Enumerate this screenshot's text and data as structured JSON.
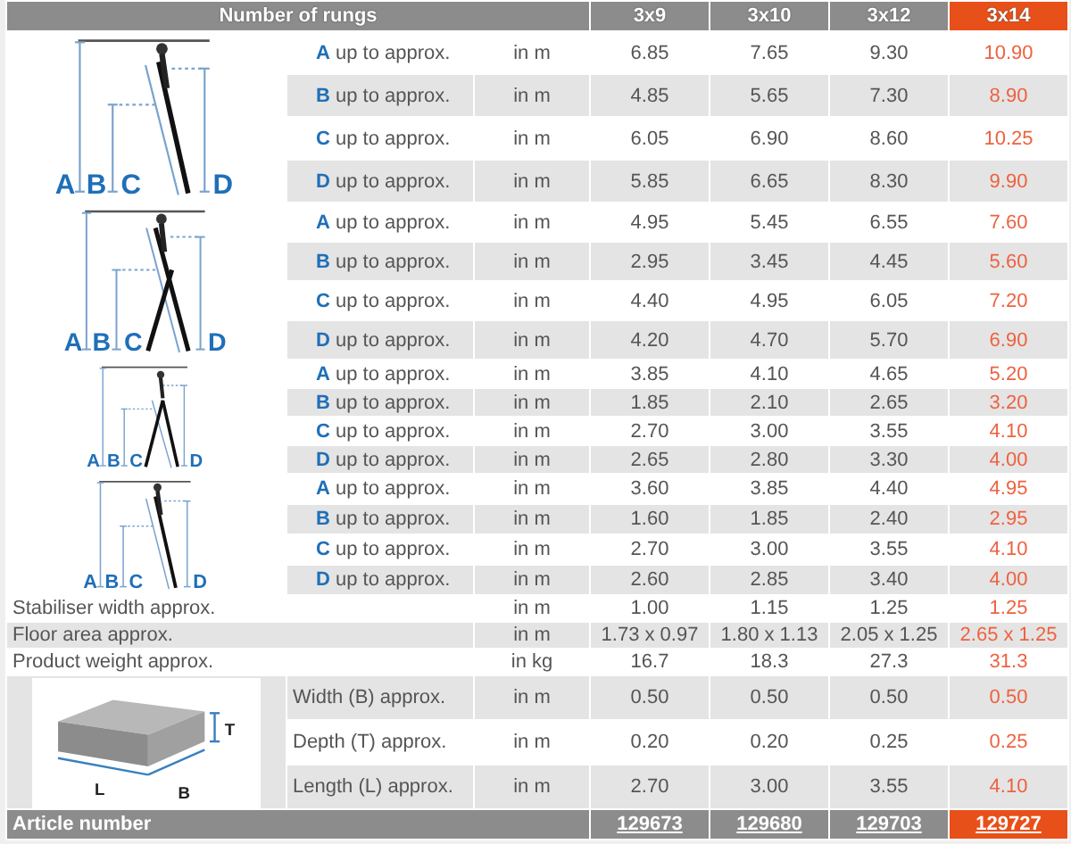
{
  "header": {
    "label": "Number of rungs",
    "columns": [
      {
        "label": "3x9",
        "selected": false
      },
      {
        "label": "3x10",
        "selected": false
      },
      {
        "label": "3x12",
        "selected": false
      },
      {
        "label": "3x14",
        "selected": true
      }
    ]
  },
  "ladder_groups": [
    {
      "kind": "lean",
      "dimension_labels": [
        "A",
        "B",
        "C",
        "D"
      ],
      "rows": [
        {
          "letter": "A",
          "label": "up to approx.",
          "unit": "in m",
          "values": [
            "6.85",
            "7.65",
            "9.30",
            "10.90"
          ]
        },
        {
          "letter": "B",
          "label": "up to approx.",
          "unit": "in m",
          "values": [
            "4.85",
            "5.65",
            "7.30",
            "8.90"
          ]
        },
        {
          "letter": "C",
          "label": "up to approx.",
          "unit": "in m",
          "values": [
            "6.05",
            "6.90",
            "8.60",
            "10.25"
          ]
        },
        {
          "letter": "D",
          "label": "up to approx.",
          "unit": "in m",
          "values": [
            "5.85",
            "6.65",
            "8.30",
            "9.90"
          ]
        }
      ]
    },
    {
      "kind": "aframe_extended",
      "dimension_labels": [
        "A",
        "B",
        "C",
        "D"
      ],
      "rows": [
        {
          "letter": "A",
          "label": "up to approx.",
          "unit": "in m",
          "values": [
            "4.95",
            "5.45",
            "6.55",
            "7.60"
          ]
        },
        {
          "letter": "B",
          "label": "up to approx.",
          "unit": "in m",
          "values": [
            "2.95",
            "3.45",
            "4.45",
            "5.60"
          ]
        },
        {
          "letter": "C",
          "label": "up to approx.",
          "unit": "in m",
          "values": [
            "4.40",
            "4.95",
            "6.05",
            "7.20"
          ]
        },
        {
          "letter": "D",
          "label": "up to approx.",
          "unit": "in m",
          "values": [
            "4.20",
            "4.70",
            "5.70",
            "6.90"
          ]
        }
      ]
    },
    {
      "kind": "aframe",
      "dimension_labels": [
        "A",
        "B",
        "C",
        "D"
      ],
      "rows": [
        {
          "letter": "A",
          "label": "up to approx.",
          "unit": "in m",
          "values": [
            "3.85",
            "4.10",
            "4.65",
            "5.20"
          ]
        },
        {
          "letter": "B",
          "label": "up to approx.",
          "unit": "in m",
          "values": [
            "1.85",
            "2.10",
            "2.65",
            "3.20"
          ]
        },
        {
          "letter": "C",
          "label": "up to approx.",
          "unit": "in m",
          "values": [
            "2.70",
            "3.00",
            "3.55",
            "4.10"
          ]
        },
        {
          "letter": "D",
          "label": "up to approx.",
          "unit": "in m",
          "values": [
            "2.65",
            "2.80",
            "3.30",
            "4.00"
          ]
        }
      ]
    },
    {
      "kind": "lean",
      "dimension_labels": [
        "A",
        "B",
        "C",
        "D"
      ],
      "rows": [
        {
          "letter": "A",
          "label": "up to approx.",
          "unit": "in m",
          "values": [
            "3.60",
            "3.85",
            "4.40",
            "4.95"
          ]
        },
        {
          "letter": "B",
          "label": "up to approx.",
          "unit": "in m",
          "values": [
            "1.60",
            "1.85",
            "2.40",
            "2.95"
          ]
        },
        {
          "letter": "C",
          "label": "up to approx.",
          "unit": "in m",
          "values": [
            "2.70",
            "3.00",
            "3.55",
            "4.10"
          ]
        },
        {
          "letter": "D",
          "label": "up to approx.",
          "unit": "in m",
          "values": [
            "2.60",
            "2.85",
            "3.40",
            "4.00"
          ]
        }
      ]
    }
  ],
  "general_rows": [
    {
      "label": "Stabiliser width approx.",
      "unit": "in m",
      "values": [
        "1.00",
        "1.15",
        "1.25",
        "1.25"
      ]
    },
    {
      "label": "Floor area approx.",
      "unit": "in m",
      "values": [
        "1.73 x 0.97",
        "1.80 x 1.13",
        "2.05 x 1.25",
        "2.65 x 1.25"
      ]
    },
    {
      "label": "Product weight approx.",
      "unit": "in kg",
      "values": [
        "16.7",
        "18.3",
        "27.3",
        "31.3"
      ]
    }
  ],
  "packaging": {
    "dimension_labels": [
      "T",
      "L",
      "B"
    ],
    "rows": [
      {
        "label": "Width (B) approx.",
        "unit": "in m",
        "values": [
          "0.50",
          "0.50",
          "0.50",
          "0.50"
        ]
      },
      {
        "label": "Depth (T) approx.",
        "unit": "in m",
        "values": [
          "0.20",
          "0.20",
          "0.25",
          "0.25"
        ]
      },
      {
        "label": "Length (L) approx.",
        "unit": "in m",
        "values": [
          "2.70",
          "3.00",
          "3.55",
          "4.10"
        ]
      }
    ]
  },
  "article": {
    "label": "Article number",
    "values": [
      "129673",
      "129680",
      "129703",
      "129727"
    ]
  }
}
